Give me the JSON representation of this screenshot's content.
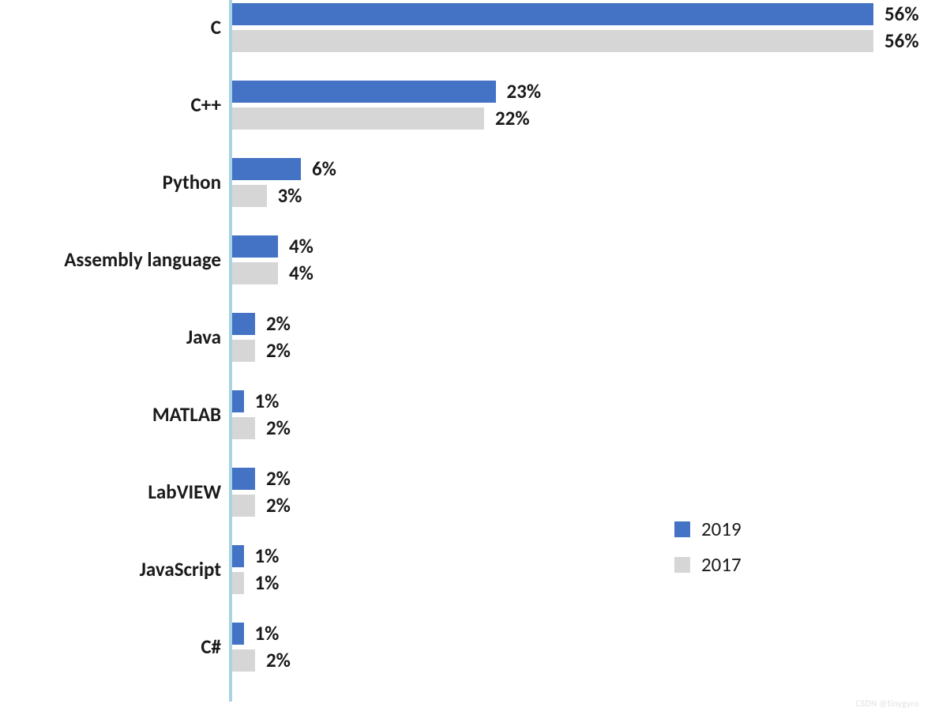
{
  "chart_data": {
    "type": "bar",
    "orientation": "horizontal",
    "categories": [
      "C",
      "C++",
      "Python",
      "Assembly language",
      "Java",
      "MATLAB",
      "LabVIEW",
      "JavaScript",
      "C#"
    ],
    "series": [
      {
        "name": "2019",
        "values": [
          56,
          23,
          6,
          4,
          2,
          1,
          2,
          1,
          1
        ],
        "color": "#4472c4"
      },
      {
        "name": "2017",
        "values": [
          56,
          22,
          3,
          4,
          2,
          2,
          2,
          1,
          2
        ],
        "color": "#d6d6d6"
      }
    ],
    "value_suffix": "%",
    "xlim": [
      0,
      56
    ],
    "title": "",
    "xlabel": "",
    "ylabel": "",
    "legend_position": "right"
  },
  "watermark": "CSDN @tinygyro"
}
